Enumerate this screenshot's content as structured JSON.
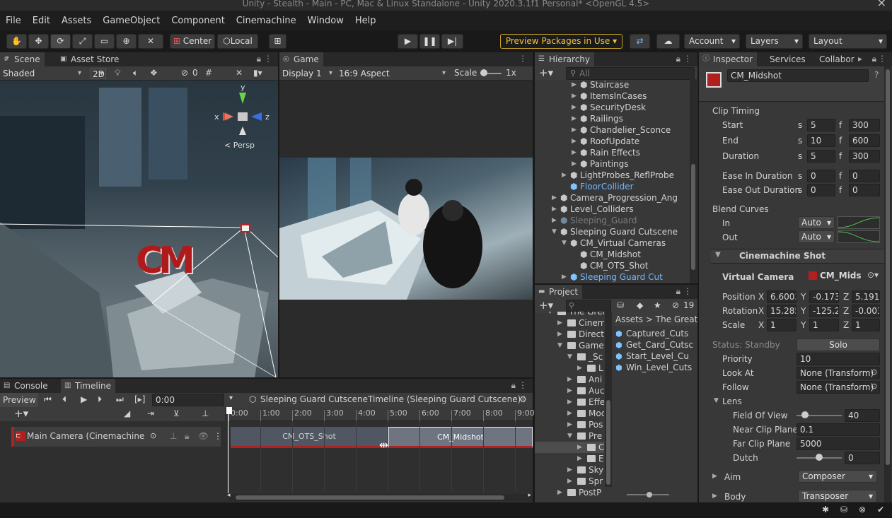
{
  "window": {
    "title": "Unity - Stealth - Main - PC, Mac & Linux Standalone - Unity 2020.3.1f1 Personal* <OpenGL 4.5>"
  },
  "menu": [
    "File",
    "Edit",
    "Assets",
    "GameObject",
    "Component",
    "Cinemachine",
    "Window",
    "Help"
  ],
  "toolbar": {
    "center": "Center",
    "local": "Local",
    "preview_packages": "Preview Packages in Use",
    "account": "Account",
    "layers": "Layers",
    "layout": "Layout"
  },
  "scene": {
    "tab": "Scene",
    "asset_store_tab": "Asset Store",
    "shading": "Shaded",
    "mode_2d": "2D",
    "hidden_count": "0",
    "persp": "< Persp",
    "axis_x": "x",
    "axis_y": "y",
    "axis_z": "z",
    "cm_logo": "CM"
  },
  "game": {
    "tab": "Game",
    "display": "Display 1",
    "aspect": "16:9 Aspect",
    "scale_label": "Scale",
    "scale_value": "1x"
  },
  "hierarchy": {
    "tab": "Hierarchy",
    "search_placeholder": "All",
    "items": [
      {
        "label": "Staircase",
        "depth": 2,
        "expand": "right",
        "color": "normal"
      },
      {
        "label": "ItemsInCases",
        "depth": 2,
        "expand": "right",
        "color": "normal"
      },
      {
        "label": "SecurityDesk",
        "depth": 2,
        "expand": "right",
        "color": "normal"
      },
      {
        "label": "Railings",
        "depth": 2,
        "expand": "right",
        "color": "normal"
      },
      {
        "label": "Chandelier_Sconce",
        "depth": 2,
        "expand": "right",
        "color": "normal"
      },
      {
        "label": "RoofUpdate",
        "depth": 2,
        "expand": "right",
        "color": "normal"
      },
      {
        "label": "Rain Effects",
        "depth": 2,
        "expand": "right",
        "color": "normal"
      },
      {
        "label": "Paintings",
        "depth": 2,
        "expand": "right",
        "color": "normal"
      },
      {
        "label": "LightProbes_ReflProbe",
        "depth": 1,
        "expand": "right",
        "color": "normal"
      },
      {
        "label": "FloorCollider",
        "depth": 1,
        "expand": "none",
        "color": "blue"
      },
      {
        "label": "Camera_Progression_Ang",
        "depth": 0,
        "expand": "right",
        "color": "normal"
      },
      {
        "label": "Level_Colliders",
        "depth": 0,
        "expand": "right",
        "color": "normal"
      },
      {
        "label": "Sleeping_Guard",
        "depth": 0,
        "expand": "right",
        "color": "dim"
      },
      {
        "label": "Sleeping Guard Cutscene",
        "depth": 0,
        "expand": "down",
        "color": "normal"
      },
      {
        "label": "CM_Virtual Cameras",
        "depth": 1,
        "expand": "down",
        "color": "normal"
      },
      {
        "label": "CM_Midshot",
        "depth": 2,
        "expand": "none",
        "color": "normal"
      },
      {
        "label": "CM_OTS_Shot",
        "depth": 2,
        "expand": "none",
        "color": "normal"
      },
      {
        "label": "Sleeping Guard Cut",
        "depth": 1,
        "expand": "right",
        "color": "blue"
      }
    ]
  },
  "inspector": {
    "tab": "Inspector",
    "services_tab": "Services",
    "collab_tab": "Collabor",
    "object_name": "CM_Midshot",
    "clip_timing": "Clip Timing",
    "start": {
      "label": "Start",
      "s": "5",
      "f": "300"
    },
    "end": {
      "label": "End",
      "s": "10",
      "f": "600"
    },
    "duration": {
      "label": "Duration",
      "s": "5",
      "f": "300"
    },
    "ease_in": {
      "label": "Ease In Duration",
      "s": "0",
      "f": "0"
    },
    "ease_out": {
      "label": "Ease Out Duration",
      "s": "0",
      "f": "0"
    },
    "s_label": "s",
    "f_label": "f",
    "blend_curves": "Blend Curves",
    "in_label": "In",
    "out_label": "Out",
    "in_value": "Auto",
    "out_value": "Auto",
    "cm_shot": "Cinemachine Shot",
    "virtual_camera": "Virtual Camera",
    "virtual_camera_value": "CM_Mids",
    "position": {
      "label": "Position",
      "x": "6.6003",
      "y": "-0.173",
      "z": "5.1915"
    },
    "rotation": {
      "label": "Rotation",
      "x": "15.285",
      "y": "-125.2",
      "z": "-0.003"
    },
    "scale": {
      "label": "Scale",
      "x": "1",
      "y": "1",
      "z": "1"
    },
    "status": "Status: Standby",
    "solo": "Solo",
    "priority": {
      "label": "Priority",
      "value": "10"
    },
    "look_at": {
      "label": "Look At",
      "value": "None (Transform)"
    },
    "follow": {
      "label": "Follow",
      "value": "None (Transform)"
    },
    "lens": "Lens",
    "fov": {
      "label": "Field Of View",
      "value": "40",
      "fraction": 0.12
    },
    "near": {
      "label": "Near Clip Plane",
      "value": "0.1"
    },
    "far": {
      "label": "Far Clip Plane",
      "value": "5000"
    },
    "dutch": {
      "label": "Dutch",
      "value": "0",
      "fraction": 0.5
    },
    "aim": {
      "label": "Aim",
      "value": "Composer"
    },
    "body": {
      "label": "Body",
      "value": "Transposer"
    },
    "x_label": "X",
    "y_label": "Y",
    "z_label": "Z"
  },
  "project": {
    "tab": "Project",
    "count": "19",
    "breadcrumb_root": "Assets",
    "breadcrumb_sep": ">",
    "breadcrumb_current": "The Great",
    "tree": [
      {
        "label": "The Grea",
        "depth": 0,
        "open": true
      },
      {
        "label": "Cinem",
        "depth": 1,
        "open": false
      },
      {
        "label": "Direct",
        "depth": 1,
        "open": false
      },
      {
        "label": "Game",
        "depth": 1,
        "open": true
      },
      {
        "label": "_Sc",
        "depth": 2,
        "open": true
      },
      {
        "label": "L",
        "depth": 3,
        "open": false
      },
      {
        "label": "Ani",
        "depth": 2,
        "open": false
      },
      {
        "label": "Auc",
        "depth": 2,
        "open": false
      },
      {
        "label": "Effe",
        "depth": 2,
        "open": false
      },
      {
        "label": "Moc",
        "depth": 2,
        "open": false
      },
      {
        "label": "Pos",
        "depth": 2,
        "open": false
      },
      {
        "label": "Pre",
        "depth": 2,
        "open": true
      },
      {
        "label": "C",
        "depth": 3,
        "open": false,
        "sel": true
      },
      {
        "label": "E",
        "depth": 3,
        "open": false
      },
      {
        "label": "Sky",
        "depth": 2,
        "open": false
      },
      {
        "label": "Spr",
        "depth": 2,
        "open": false
      },
      {
        "label": "PostP",
        "depth": 1,
        "open": false
      }
    ],
    "files": [
      "Captured_Cuts",
      "Get_Card_Cutsc",
      "Start_Level_Cu",
      "Win_Level_Cuts"
    ]
  },
  "timeline": {
    "console_tab": "Console",
    "tab": "Timeline",
    "preview": "Preview",
    "time": "0:00",
    "asset": "Sleeping Guard CutsceneTimeline (Sleeping Guard Cutscene)",
    "ruler": [
      "0:00",
      "1:00",
      "2:00",
      "3:00",
      "4:00",
      "5:00",
      "6:00",
      "7:00",
      "8:00",
      "9:00"
    ],
    "track": "Main Camera (Cinemachine",
    "clip1": "CM_OTS_Shot",
    "clip2": "CM_Midshot"
  }
}
